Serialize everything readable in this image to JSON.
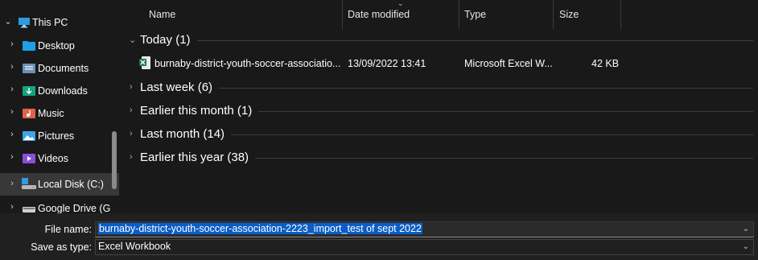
{
  "nav": {
    "items": [
      {
        "label": "This PC",
        "chevron": "⌄",
        "icon": "pc-icon"
      },
      {
        "label": "Desktop",
        "chevron": "›",
        "icon": "desktop-folder-icon"
      },
      {
        "label": "Documents",
        "chevron": "›",
        "icon": "documents-folder-icon"
      },
      {
        "label": "Downloads",
        "chevron": "›",
        "icon": "downloads-folder-icon"
      },
      {
        "label": "Music",
        "chevron": "›",
        "icon": "music-folder-icon"
      },
      {
        "label": "Pictures",
        "chevron": "›",
        "icon": "pictures-folder-icon"
      },
      {
        "label": "Videos",
        "chevron": "›",
        "icon": "videos-folder-icon"
      },
      {
        "label": "Local Disk (C:)",
        "chevron": "›",
        "icon": "local-disk-icon"
      },
      {
        "label": "Google Drive (G",
        "chevron": "›",
        "icon": "google-drive-icon"
      }
    ]
  },
  "columns": {
    "name": "Name",
    "date_modified": "Date modified",
    "type": "Type",
    "size": "Size",
    "sort_indicator": "⌄"
  },
  "groups": [
    {
      "title": "Today (1)",
      "chevron": "⌄"
    },
    {
      "title": "Last week (6)",
      "chevron": "›"
    },
    {
      "title": "Earlier this month (1)",
      "chevron": "›"
    },
    {
      "title": "Last month (14)",
      "chevron": "›"
    },
    {
      "title": "Earlier this year (38)",
      "chevron": "›"
    }
  ],
  "file": {
    "name": "burnaby-district-youth-soccer-associatio...",
    "date_modified": "13/09/2022 13:41",
    "type": "Microsoft Excel W...",
    "size": "42 KB",
    "icon": "excel-file-icon"
  },
  "form": {
    "file_name_label": "File name:",
    "file_name_value": "burnaby-district-youth-soccer-association-2223_import_test of sept 2022",
    "save_as_type_label": "Save as type:",
    "save_as_type_value": "Excel Workbook",
    "dropdown_glyph": "⌄"
  },
  "colors": {
    "background": "#191919",
    "selection": "#0a5ec8",
    "excel_green": "#1d7a45"
  }
}
